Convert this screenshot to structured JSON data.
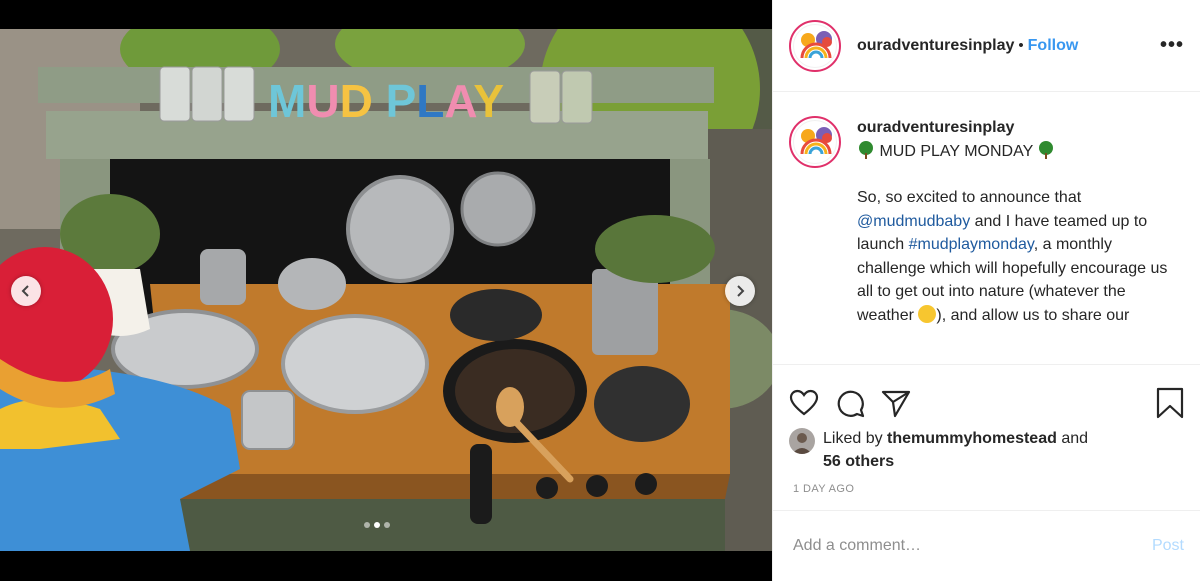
{
  "post": {
    "username": "ouradventuresinplay",
    "separator": "•",
    "follow_label": "Follow",
    "more_label": "•••"
  },
  "media": {
    "sign_text": "MUD PLAY",
    "slide_count": 3,
    "active_slide": 2
  },
  "caption": {
    "username": "ouradventuresinplay",
    "title": "MUD PLAY MONDAY",
    "line_prefix": "So, so excited to announce that",
    "mention": "@mudmudbaby",
    "mid_text": " and I have teamed up to launch ",
    "hashtag": "#mudplaymonday",
    "rest_text": ", a monthly challenge which will hopefully encourage us all to get out into nature (whatever the weather ",
    "end_text": "), and allow us to share our"
  },
  "likes": {
    "prefix": "Liked by ",
    "user": "themummyhomestead",
    "joiner": " and",
    "others": "56 others"
  },
  "timestamp": "1 DAY AGO",
  "comment_box": {
    "placeholder": "Add a comment…",
    "post_label": "Post"
  },
  "colors": {
    "accent": "#3897f0",
    "link": "#1f5a9e",
    "muted": "#8e8e8e",
    "post_disabled": "#b3dbff",
    "border": "#efefef"
  }
}
